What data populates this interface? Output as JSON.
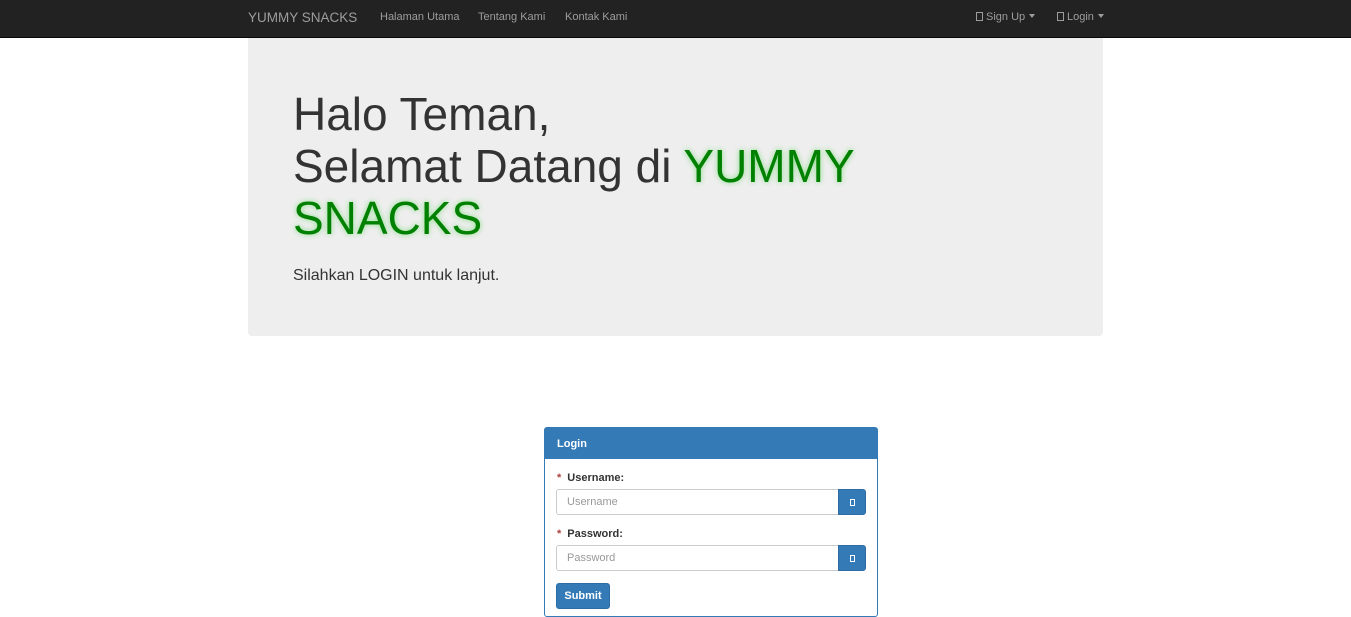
{
  "navbar": {
    "brand": "YUMMY SNACKS",
    "links": [
      "Halaman Utama",
      "Tentang Kami",
      "Kontak Kami"
    ],
    "signup_label": "Sign Up",
    "login_label": "Login"
  },
  "jumbotron": {
    "greeting": "Halo Teman,",
    "welcome_prefix": "Selamat Datang di",
    "brand_highlight": "YUMMY SNACKS",
    "lead": "Silahkan LOGIN untuk lanjut."
  },
  "login_panel": {
    "title": "Login",
    "username_label": "Username:",
    "username_placeholder": "Username",
    "password_label": "Password:",
    "password_placeholder": "Password",
    "required_marker": "*",
    "submit_label": "Submit"
  },
  "colors": {
    "navbar_bg": "#222222",
    "jumbotron_bg": "#eeeeee",
    "brand_green": "#008000",
    "primary_blue": "#337ab7"
  },
  "icons": {
    "signup": "user-icon",
    "login": "login-icon",
    "username_addon": "user-icon",
    "password_addon": "lock-icon"
  }
}
